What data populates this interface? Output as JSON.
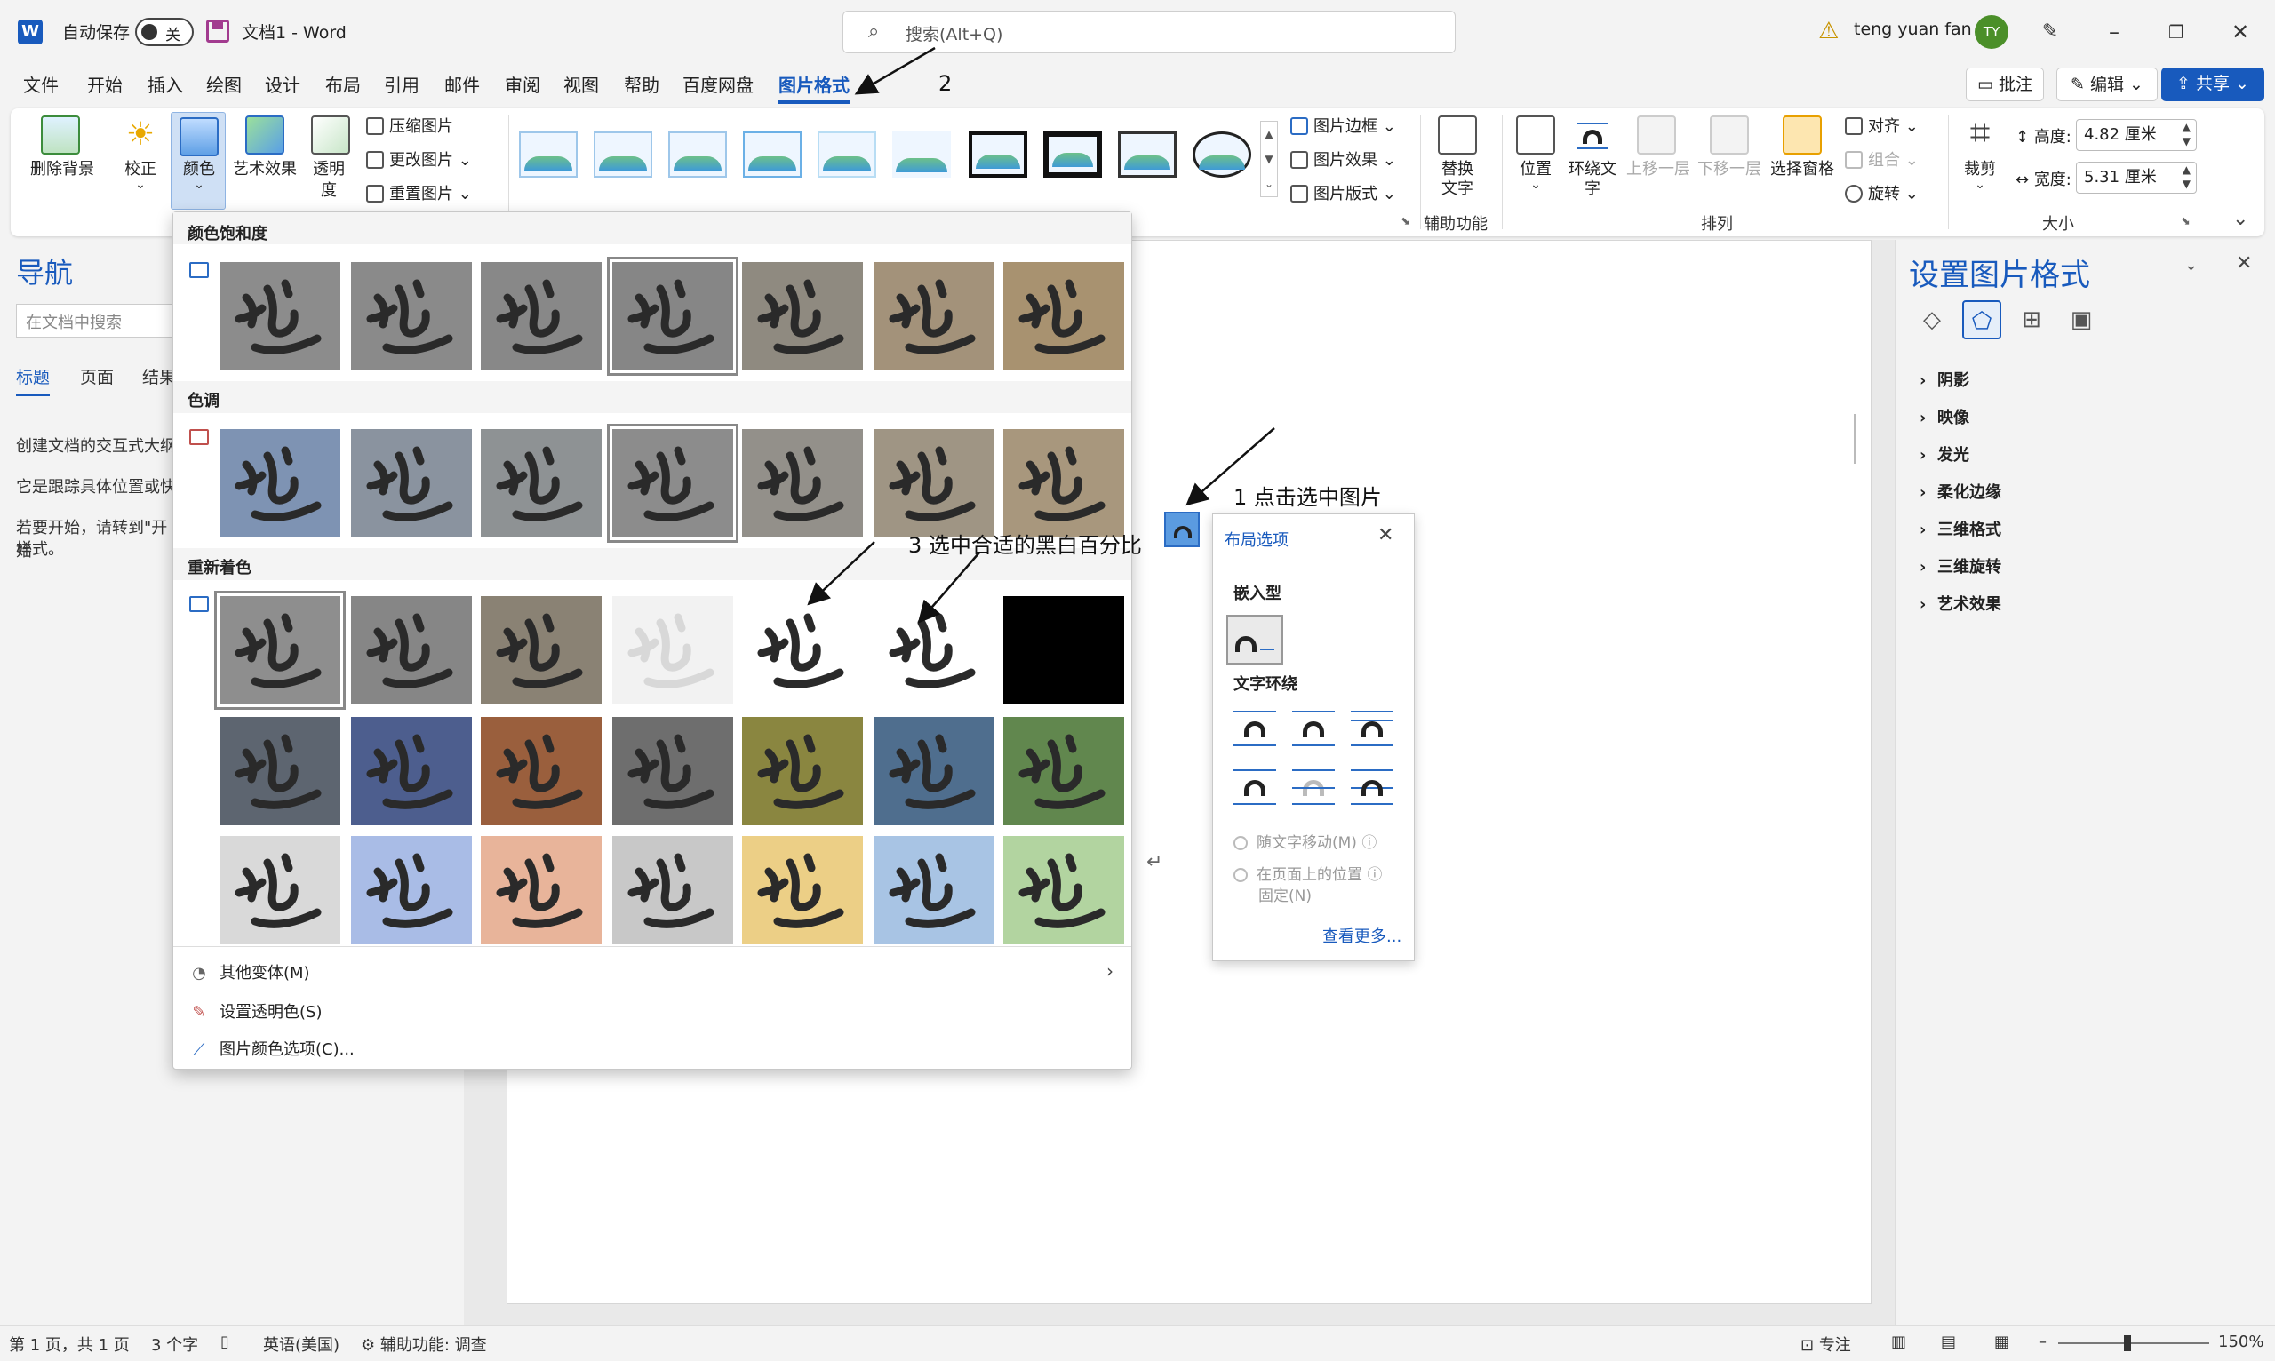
{
  "titlebar": {
    "autosave_label": "自动保存",
    "autosave_state": "关",
    "doc_title": "文档1  -  Word",
    "search_placeholder": "搜索(Alt+Q)",
    "user_name": "teng yuan fan",
    "user_initials": "TY"
  },
  "menu": {
    "tabs": [
      "文件",
      "开始",
      "插入",
      "绘图",
      "设计",
      "布局",
      "引用",
      "邮件",
      "审阅",
      "视图",
      "帮助",
      "百度网盘",
      "图片格式"
    ],
    "active_tab": "图片格式",
    "comment_btn": "批注",
    "edit_btn": "编辑",
    "share_btn": "共享"
  },
  "ribbon": {
    "remove_bg": "删除背景",
    "correct": "校正",
    "color": "颜色",
    "art_effect": "艺术效果",
    "transparency_1": "透明",
    "transparency_2": "度",
    "compress": "压缩图片",
    "change_pic": "更改图片",
    "reset_pic": "重置图片",
    "border": "图片边框",
    "effects": "图片效果",
    "layout": "图片版式",
    "alt_text_1": "替换",
    "alt_text_2": "文字",
    "accessibility_group": "辅助功能",
    "position": "位置",
    "wrap_text_1": "环绕文",
    "wrap_text_2": "字",
    "bring_forward": "上移一层",
    "send_backward": "下移一层",
    "selection_pane": "选择窗格",
    "align": "对齐",
    "group": "组合",
    "rotate": "旋转",
    "arrange_group": "排列",
    "crop": "裁剪",
    "height_label": "高度:",
    "height_value": "4.82 厘米",
    "width_label": "宽度:",
    "width_value": "5.31 厘米",
    "size_group": "大小"
  },
  "nav": {
    "title": "导航",
    "search_placeholder": "在文档中搜索",
    "tabs": [
      "标题",
      "页面",
      "结果"
    ],
    "text_1": "创建文档的交互式大纲",
    "text_2": "它是跟踪具体位置或快",
    "text_3a": "若要开始，请转到\"开始",
    "text_3b": "样式。"
  },
  "color_panel": {
    "saturation_header": "颜色饱和度",
    "tone_header": "色调",
    "recolor_header": "重新着色",
    "more_variations": "其他变体(M)",
    "set_transparent": "设置透明色(S)",
    "color_options": "图片颜色选项(C)...",
    "saturation_swatches": [
      "#8c8c8c",
      "#8a8a8a",
      "#888888",
      "#868686",
      "#8f8a80",
      "#a3927a",
      "#a89270"
    ],
    "tone_swatches": [
      "#7e93b3",
      "#8a939f",
      "#8e9294",
      "#8c8c8c",
      "#93908a",
      "#9f9584",
      "#a8977d"
    ],
    "recolor_swatches": [
      [
        "#8e8e8e",
        "#868686",
        "#8a8274",
        "#f2f2f2",
        "#ffffff",
        "#ffffff",
        "#000000"
      ],
      [
        "#5d6570",
        "#4d5e8e",
        "#9a5f3d",
        "#6e6e6e",
        "#8a8640",
        "#4f6e8e",
        "#61874e"
      ],
      [
        "#d9d9d9",
        "#a9bce6",
        "#e8b49a",
        "#c8c8c8",
        "#eccf86",
        "#a8c4e4",
        "#b2d4a0"
      ]
    ]
  },
  "layout_popup": {
    "title": "布局选项",
    "inline_header": "嵌入型",
    "wrap_header": "文字环绕",
    "move_with_text": "随文字移动(M)",
    "fix_position_1": "在页面上的位置",
    "fix_position_2": "固定(N)",
    "see_more": "查看更多..."
  },
  "right_pane": {
    "title": "设置图片格式",
    "items": [
      "阴影",
      "映像",
      "发光",
      "柔化边缘",
      "三维格式",
      "三维旋转",
      "艺术效果"
    ]
  },
  "annotations": {
    "a1": "1 点击选中图片",
    "a2": "2",
    "a3": "3 选中合适的黑白百分比"
  },
  "status": {
    "page": "第 1 页，共 1 页",
    "words": "3 个字",
    "language": "英语(美国)",
    "accessibility": "辅助功能: 调查",
    "focus": "专注",
    "zoom": "150%"
  },
  "colors": {
    "accent": "#185abd",
    "share_bg": "#185abd",
    "avatar_bg": "#4b8f29"
  }
}
